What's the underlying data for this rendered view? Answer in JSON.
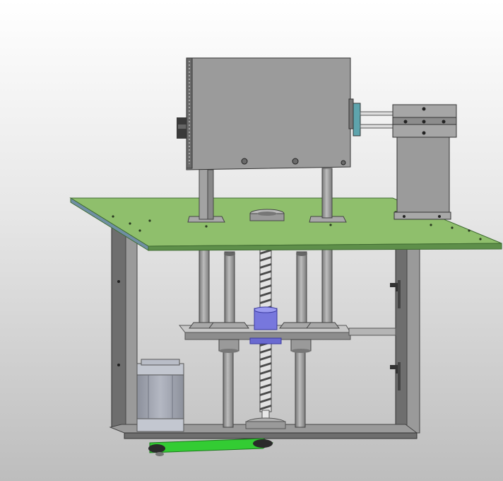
{
  "viewport": {
    "background_top": "#ffffff",
    "background_bottom": "#bdbdbd"
  },
  "colors": {
    "plate_green": "#8fbf6c",
    "plate_edge": "#5e8f4a",
    "metal_gray": "#9a9a9a",
    "metal_dark": "#6e6e6e",
    "metal_light": "#c4c4c4",
    "nut_blue": "#7777dd",
    "belt_green": "#33cc33",
    "motor_gray": "#a9adb8"
  },
  "model": {
    "parts": [
      "top-housing",
      "side-block",
      "main-plate",
      "frame-left-leg",
      "frame-right-leg",
      "frame-bottom-beam",
      "guide-rods",
      "lead-screw",
      "lead-screw-nut",
      "moving-carriage",
      "stepper-motor",
      "drive-belt"
    ]
  }
}
